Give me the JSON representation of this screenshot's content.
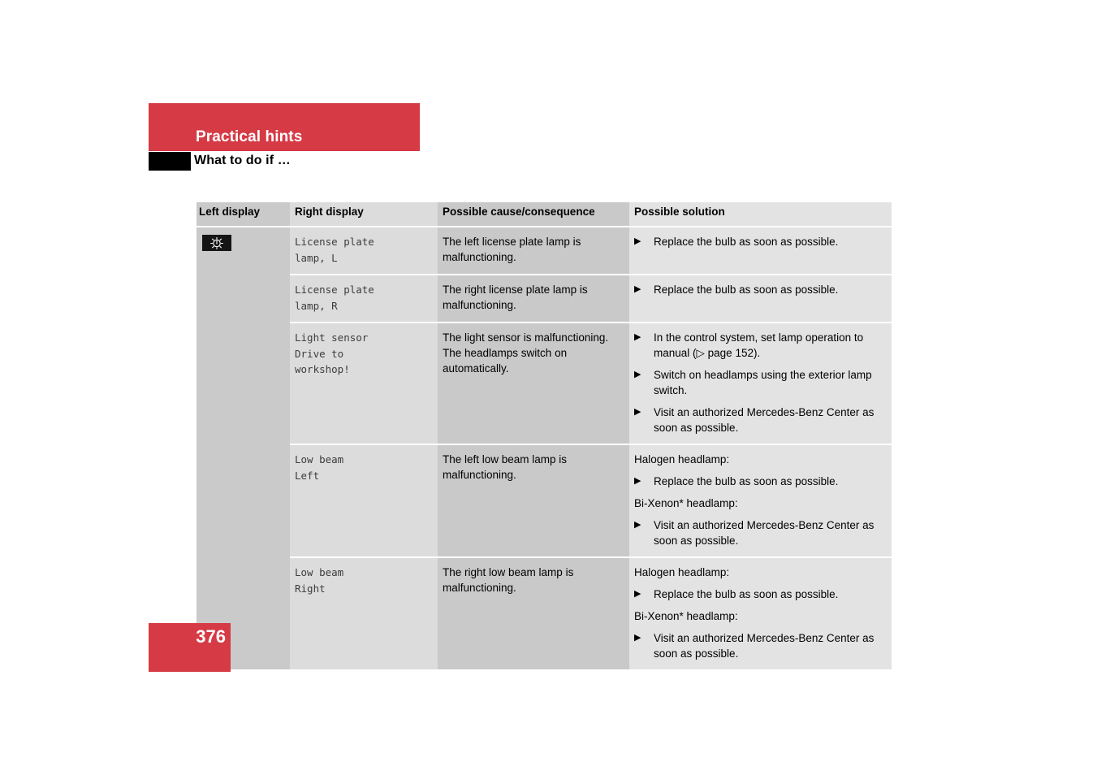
{
  "header": {
    "chapter_title": "Practical hints",
    "section_title": "What to do if …",
    "banner_color": "#d63a45",
    "block_color": "#000000"
  },
  "footer": {
    "page_number": "376",
    "color": "#d63a45"
  },
  "table": {
    "columns": [
      "Left display",
      "Right display",
      "Possible cause/consequence",
      "Possible solution"
    ],
    "column_colors": [
      "#cacaca",
      "#dcdcdc",
      "#c9c9c9",
      "#e3e3e3"
    ],
    "rows": [
      {
        "left_display_icon": "lamp-indicator-icon",
        "right_display": "License plate\nlamp, L",
        "cause": "The left license plate lamp is malfunctioning.",
        "solution": [
          {
            "type": "bullet",
            "text": "Replace the bulb as soon as possible."
          }
        ]
      },
      {
        "left_display_icon": null,
        "right_display": "License plate\nlamp, R",
        "cause": "The right license plate lamp is malfunctioning.",
        "solution": [
          {
            "type": "bullet",
            "text": "Replace the bulb as soon as possible."
          }
        ]
      },
      {
        "left_display_icon": null,
        "right_display": "Light sensor\nDrive to\nworkshop!",
        "cause": "The light sensor is malfunctioning. The headlamps switch on automatically.",
        "solution": [
          {
            "type": "bullet",
            "text": "In the control system, set lamp operation to manual (▷ page 152)."
          },
          {
            "type": "bullet",
            "text": "Switch on headlamps using the exterior lamp switch."
          },
          {
            "type": "bullet",
            "text": "Visit an authorized Mercedes-Benz Center as soon as possible."
          }
        ]
      },
      {
        "left_display_icon": null,
        "right_display": "Low beam\nLeft",
        "cause": "The left low beam lamp is malfunctioning.",
        "solution": [
          {
            "type": "label",
            "text": "Halogen headlamp:"
          },
          {
            "type": "bullet",
            "text": "Replace the bulb as soon as possible."
          },
          {
            "type": "label",
            "text": "Bi-Xenon* headlamp:"
          },
          {
            "type": "bullet",
            "text": "Visit an authorized Mercedes-Benz Center as soon as possible."
          }
        ]
      },
      {
        "left_display_icon": null,
        "right_display": "Low beam\nRight",
        "cause": "The right low beam lamp is malfunctioning.",
        "solution": [
          {
            "type": "label",
            "text": "Halogen headlamp:"
          },
          {
            "type": "bullet",
            "text": "Replace the bulb as soon as possible."
          },
          {
            "type": "label",
            "text": "Bi-Xenon* headlamp:"
          },
          {
            "type": "bullet",
            "text": "Visit an authorized Mercedes-Benz Center as soon as possible."
          }
        ]
      }
    ],
    "bullet_glyph": "▶"
  }
}
